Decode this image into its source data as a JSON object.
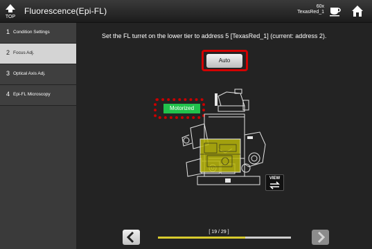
{
  "header": {
    "top_label": "TOP",
    "title": "Fluorescence(Epi-FL)",
    "objective": "60x",
    "filter": "TexasRed_1"
  },
  "sidebar": {
    "items": [
      {
        "num": "1",
        "label": "Condition Settings",
        "active": false
      },
      {
        "num": "2",
        "label": "Focus Adj.",
        "active": true
      },
      {
        "num": "3",
        "label": "Optical Axis Adj.",
        "active": false
      },
      {
        "num": "4",
        "label": "Epi-FL Microscopy",
        "active": false
      }
    ]
  },
  "main": {
    "instruction": "Set the FL turret on the lower tier to address 5 [TexasRed_1] (current: address 2).",
    "auto_label": "Auto",
    "motorized_label": "Motorized",
    "view_label": "VIEW"
  },
  "footer": {
    "page_counter": "[ 19 / 29 ]",
    "current_step": 19,
    "total_steps": 29
  },
  "colors": {
    "accent_red": "#d40000",
    "motorized_green": "#21c24c",
    "progress_yellow": "#d9cc2e"
  },
  "icons": [
    "top-icon",
    "cup-icon",
    "home-icon",
    "view-icon",
    "chevron-left-icon",
    "chevron-right-icon"
  ]
}
